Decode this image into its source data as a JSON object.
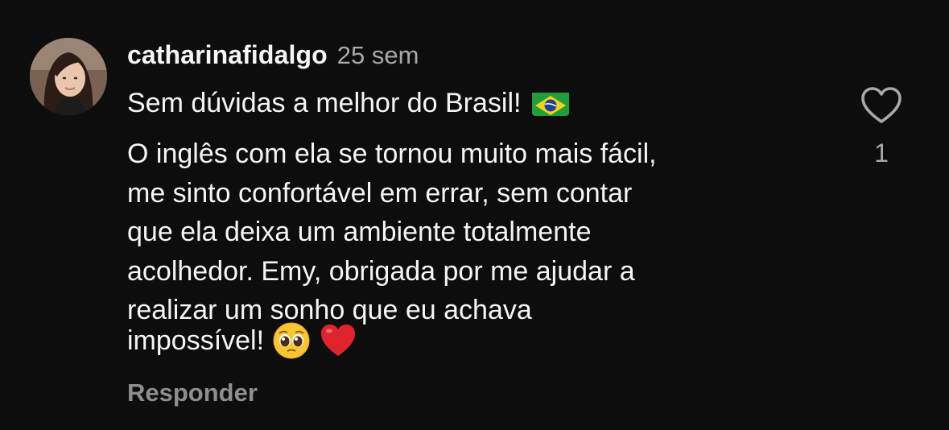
{
  "comment": {
    "username": "catharinafidalgo",
    "timestamp": "25 sem",
    "first_line": "Sem dúvidas a melhor do Brasil!",
    "body": "O inglês com ela se tornou muito mais fácil,\nme sinto confortável em errar, sem contar\nque ela deixa um ambiente totalmente\nacolhedor. Emy, obrigada por me ajudar a\nrealizar um sonho que eu achava",
    "last_line": "impossível!",
    "emojis": [
      "brazil-flag",
      "pleading-face",
      "red-heart"
    ],
    "reply_label": "Responder",
    "like_count": "1"
  },
  "colors": {
    "background": "#0d0d0d",
    "text_primary": "#f5f5f5",
    "text_secondary": "#a8a8a8",
    "reply_text": "#8e8e8e"
  },
  "icons": {
    "like": "heart-outline-icon"
  }
}
